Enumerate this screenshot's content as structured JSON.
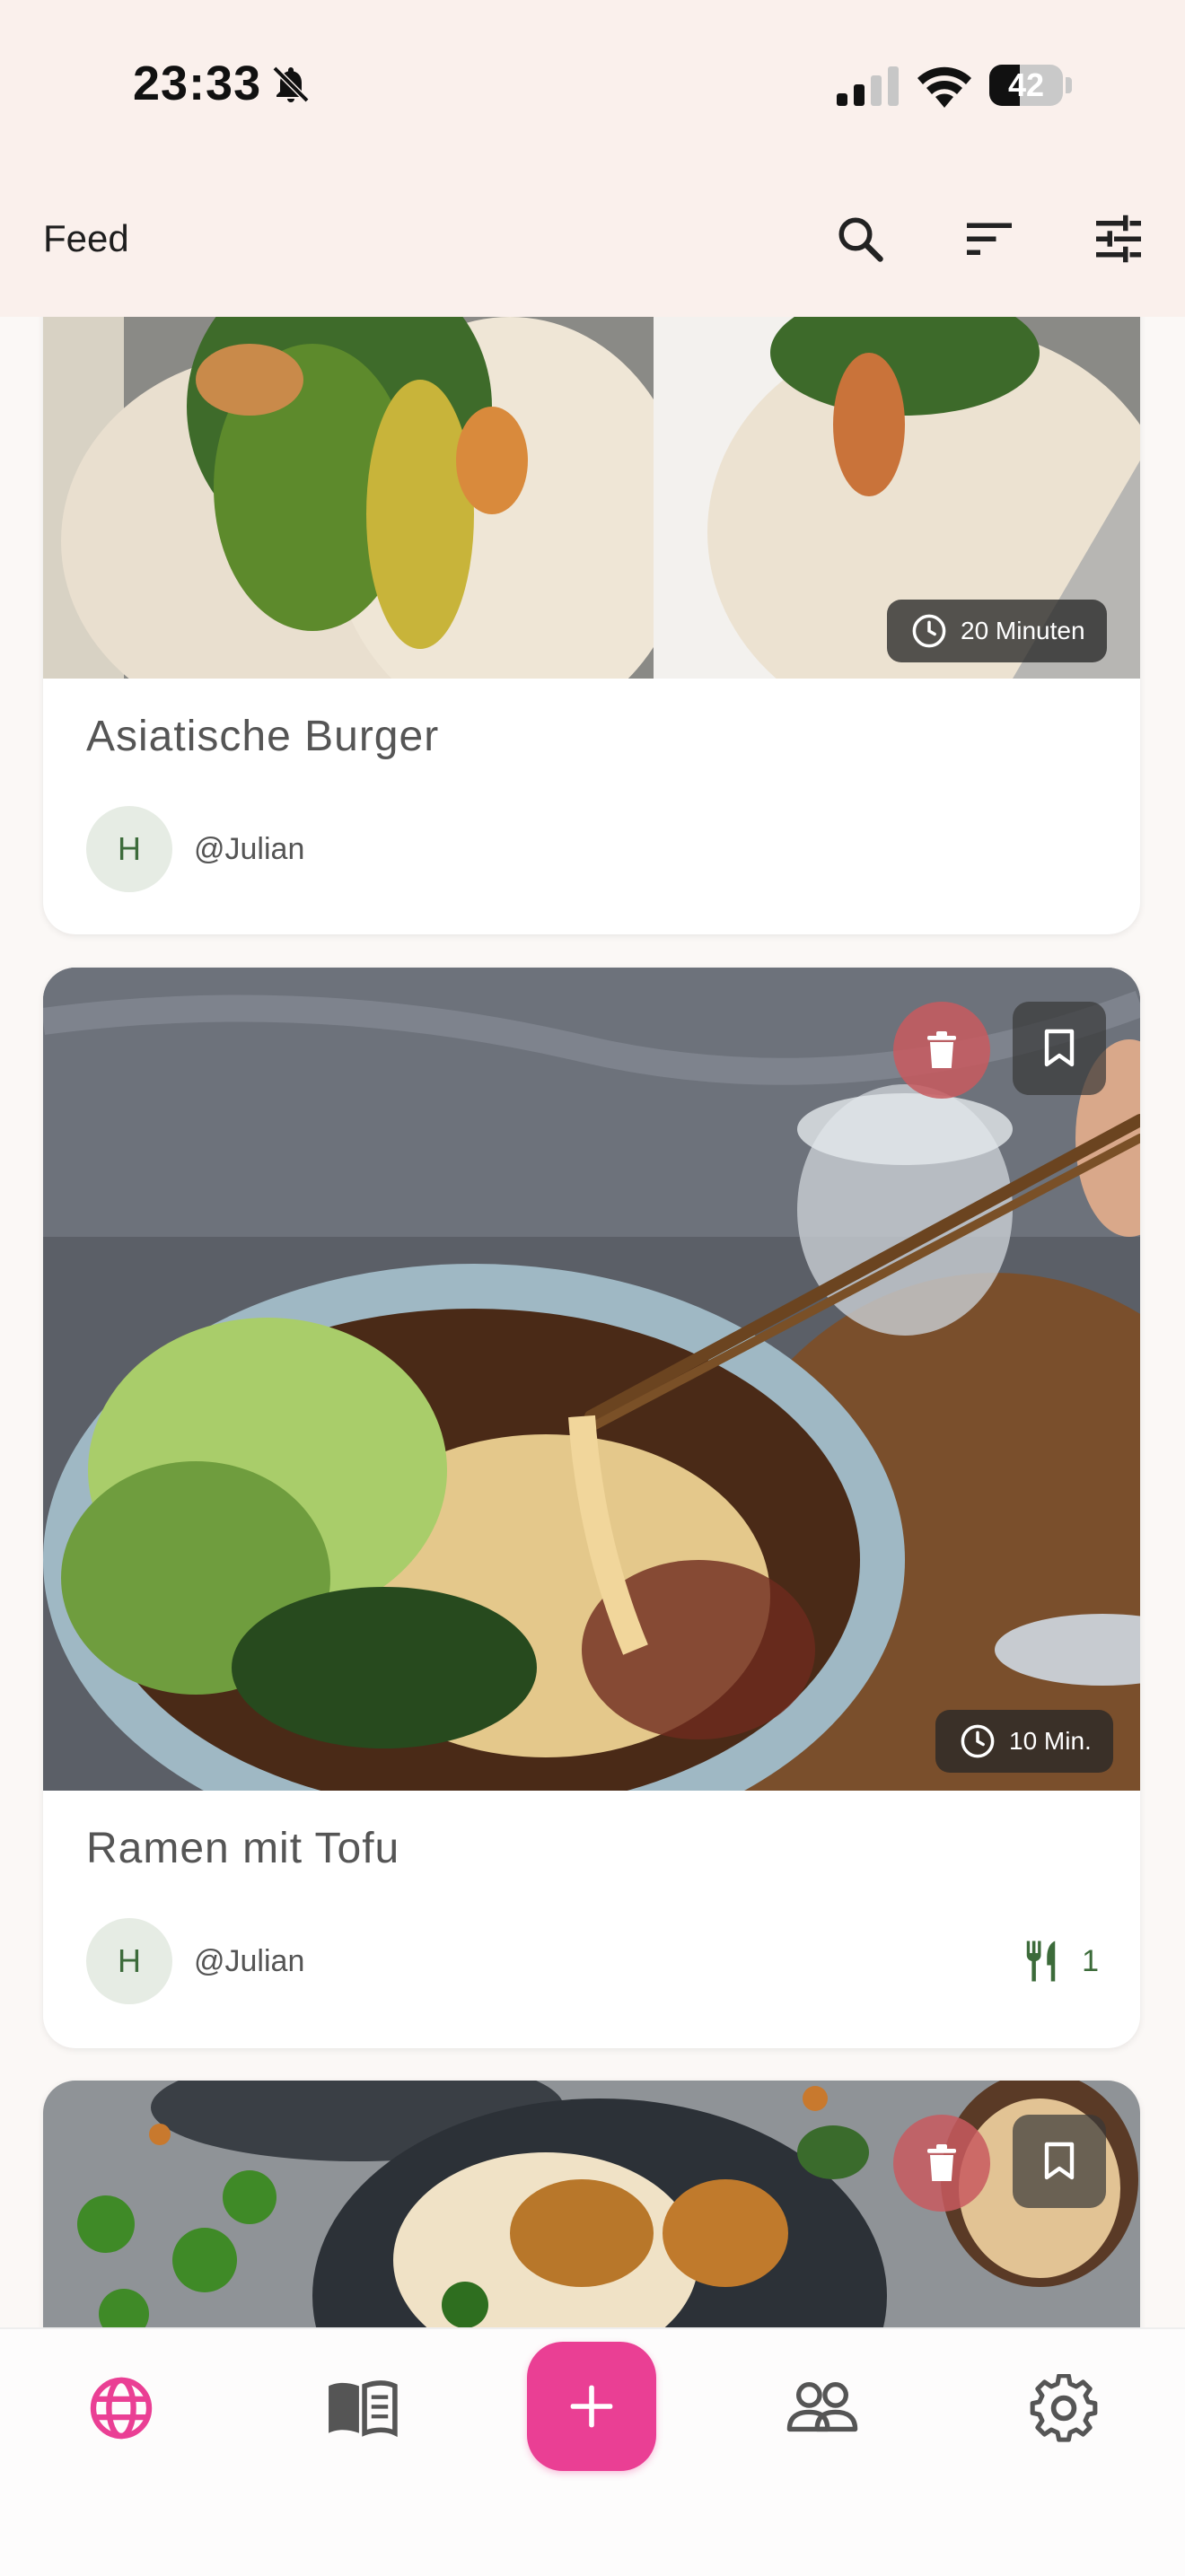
{
  "status_bar": {
    "time": "23:33",
    "battery_level": "42",
    "battery_fraction": 0.42
  },
  "app_bar": {
    "title": "Feed",
    "actions": [
      "search-icon",
      "sort-icon",
      "filter-icon"
    ]
  },
  "recipes": [
    {
      "title": "Asiatische Burger",
      "author": "@Julian",
      "avatar_initial": "H",
      "duration": "20 Minuten"
    },
    {
      "title": "Ramen mit Tofu",
      "author": "@Julian",
      "avatar_initial": "H",
      "duration": "10 Min.",
      "servings": "1"
    },
    {
      "title": "",
      "author": "",
      "avatar_initial": ""
    }
  ],
  "bottom_nav": {
    "items": [
      "globe-icon",
      "book-icon",
      "add-icon",
      "people-icon",
      "settings-icon"
    ],
    "active": "globe-icon"
  },
  "colors": {
    "accent": "#ea3f94",
    "header_bg": "#faf0ec",
    "green": "#3c6b3a",
    "delete": "#c85a5f"
  }
}
